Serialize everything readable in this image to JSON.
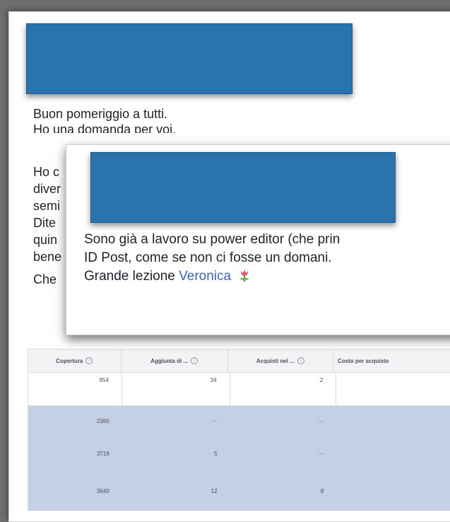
{
  "post": {
    "lines": [
      "Buon pomeriggio a tutti.",
      "Ho una domanda per voi.",
      "Ho c",
      "diver",
      "semi",
      "Dite",
      "quin",
      "bene",
      "Che"
    ]
  },
  "comment": {
    "line1": "Sono già a lavoro su power editor (che prin",
    "line2": "ID Post, come se non ci fosse un domani.",
    "line3_prefix": "Grande lezione ",
    "mention": "Veronica",
    "emoji": "tulip-icon"
  },
  "table": {
    "headers": [
      "Copertura",
      "Aggiunta di ...",
      "Acquisti nel ...",
      "Costo per acquisto"
    ],
    "rows": [
      {
        "copertura": "954",
        "aggiunta": "34",
        "acquisti": "2",
        "costo": ""
      },
      {
        "copertura": "2360",
        "aggiunta": "—",
        "acquisti": "—",
        "costo": ""
      },
      {
        "copertura": "3718",
        "aggiunta": "5",
        "acquisti": "—",
        "costo": ""
      },
      {
        "copertura": "3640",
        "aggiunta": "12",
        "acquisti": "8",
        "costo": ""
      }
    ]
  },
  "colors": {
    "redaction": "#2b73ad",
    "link": "#4267b2",
    "highlight_row": "#c5d0e6"
  }
}
